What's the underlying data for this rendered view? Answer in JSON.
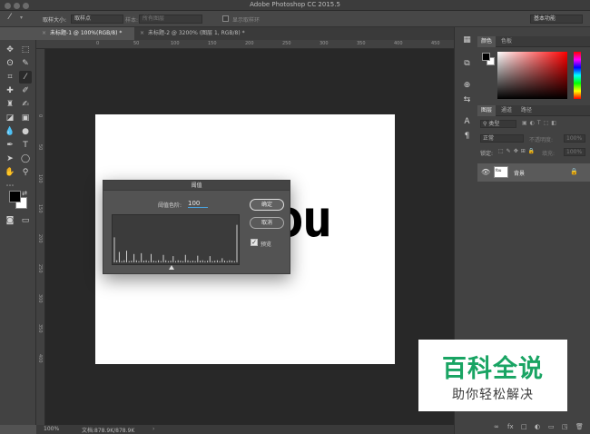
{
  "app_title": "Adobe Photoshop CC 2015.5",
  "options_bar": {
    "sample_size_label": "取样大小:",
    "sample_size_value": "取样点",
    "sample_label": "样本:",
    "sample_value": "所有图层",
    "show_ring_label": "显示取样环",
    "workspace": "基本功能"
  },
  "tabs": [
    {
      "label": "未标题-1 @ 100%(RGB/8) *"
    },
    {
      "label": "未标题-2 @ 3200% (图层 1, RGB/8) *"
    }
  ],
  "ruler_top": [
    "0",
    "50",
    "100",
    "150",
    "200",
    "250",
    "300",
    "350",
    "400",
    "450"
  ],
  "ruler_left": [
    "0",
    "50",
    "100",
    "150",
    "200",
    "250",
    "300",
    "350",
    "400"
  ],
  "canvas": {
    "text": "ou"
  },
  "status": {
    "zoom": "100%",
    "doc_size": "文档:878.9K/878.9K"
  },
  "threshold_dialog": {
    "title": "阈值",
    "level_label": "阈值色阶:",
    "level_value": "100",
    "ok_label": "确定",
    "cancel_label": "取消",
    "preview_label": "预览",
    "histogram": [
      0.6,
      0.05,
      0.25,
      0.03,
      0.05,
      0.28,
      0.03,
      0.04,
      0.2,
      0.05,
      0.03,
      0.22,
      0.04,
      0.05,
      0.03,
      0.2,
      0.04,
      0.03,
      0.05,
      0.03,
      0.18,
      0.05,
      0.03,
      0.04,
      0.15,
      0.03,
      0.05,
      0.04,
      0.03,
      0.18,
      0.05,
      0.03,
      0.04,
      0.03,
      0.16,
      0.04,
      0.05,
      0.03,
      0.04,
      0.15,
      0.03,
      0.04,
      0.05,
      0.03,
      0.1,
      0.04,
      0.03,
      0.05,
      0.04,
      0.03,
      0.9
    ],
    "slider_level": 100,
    "level_max": 255
  },
  "color_panel": {
    "tabs": [
      "颜色",
      "色板"
    ]
  },
  "layers_panel": {
    "tabs": [
      "图层",
      "通道",
      "路径"
    ],
    "kind": "类型",
    "blend": "正常",
    "opacity_label": "不透明度:",
    "opacity": "100%",
    "lock_label": "锁定:",
    "fill_label": "填充:",
    "fill": "100%",
    "layer_name": "背景",
    "thumb_text": "fou"
  },
  "footer_icons": [
    "∞",
    "fx",
    "□",
    "◐",
    "▭",
    "◳",
    "🗑"
  ],
  "watermark": {
    "big": "百科全说",
    "small": "助你轻松解决"
  },
  "colors": {
    "accent": "#4aa3df",
    "watermark_green": "#19a463"
  }
}
